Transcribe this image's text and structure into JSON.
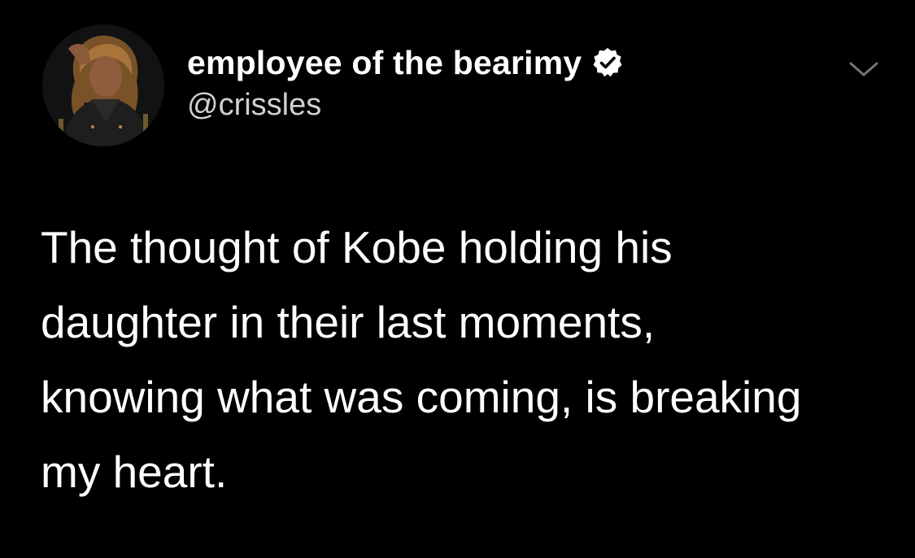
{
  "tweet": {
    "author": {
      "display_name": "employee of the bearimy",
      "handle": "@crissles",
      "verified": true,
      "avatar_icon": "profile-photo"
    },
    "text": "The thought of Kobe holding his\ndaughter in their last moments,\nknowing what was coming, is breaking\nmy heart.",
    "menu_icon": "chevron-down-icon"
  },
  "colors": {
    "background": "#000000",
    "text_primary": "#ffffff",
    "text_secondary": "#d0d0d0",
    "caret": "#6e767d"
  }
}
